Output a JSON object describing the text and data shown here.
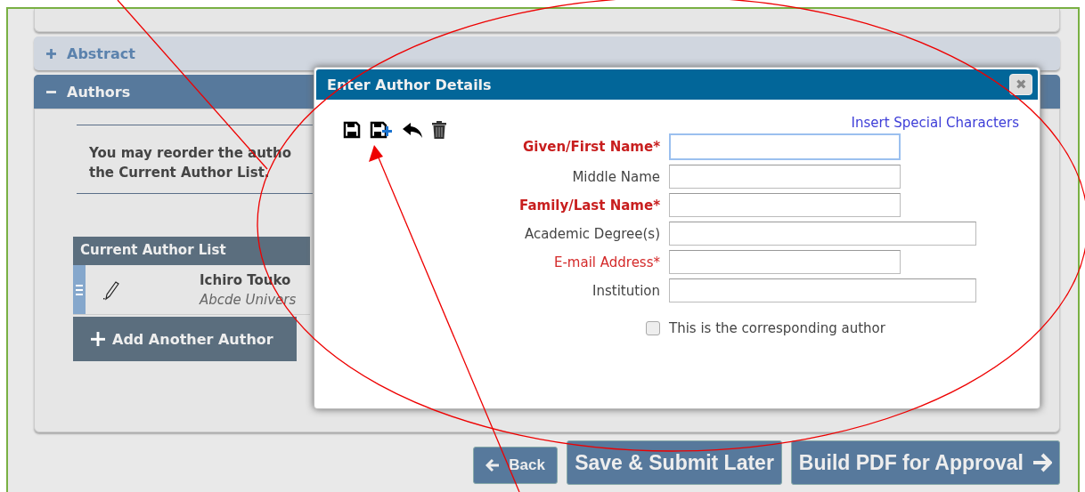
{
  "sections": [
    {
      "label": "Abstract",
      "expanded": false
    },
    {
      "label": "Authors",
      "expanded": true
    }
  ],
  "authors_panel": {
    "instruction_lines": [
      "You may reorder the autho",
      "the Current Author List."
    ],
    "list_title": "Current Author List",
    "authors": [
      {
        "name": "Ichiro Touko",
        "institution": "Abcde Univers"
      }
    ],
    "add_button": "Add Another Author"
  },
  "dialog": {
    "title": "Enter Author Details",
    "close": "✖",
    "link": "Insert Special Characters",
    "fields": [
      {
        "label": "Given/First Name*",
        "kind": "required-bold",
        "wide": false,
        "focused": true
      },
      {
        "label": "Middle Name",
        "kind": "normal",
        "wide": false,
        "focused": false
      },
      {
        "label": "Family/Last Name*",
        "kind": "required-bold",
        "wide": false,
        "focused": false
      },
      {
        "label": "Academic Degree(s)",
        "kind": "normal",
        "wide": true,
        "focused": false
      },
      {
        "label": "E-mail Address*",
        "kind": "required",
        "wide": false,
        "focused": false
      },
      {
        "label": "Institution",
        "kind": "normal",
        "wide": true,
        "focused": false
      }
    ],
    "corresponding": {
      "label": "This is the corresponding author",
      "checked": false
    }
  },
  "footer_buttons": [
    {
      "label": "Back",
      "kind": "back"
    },
    {
      "label": "Save & Submit Later",
      "kind": "plain"
    },
    {
      "label": "Build PDF for Approval",
      "kind": "next"
    }
  ]
}
